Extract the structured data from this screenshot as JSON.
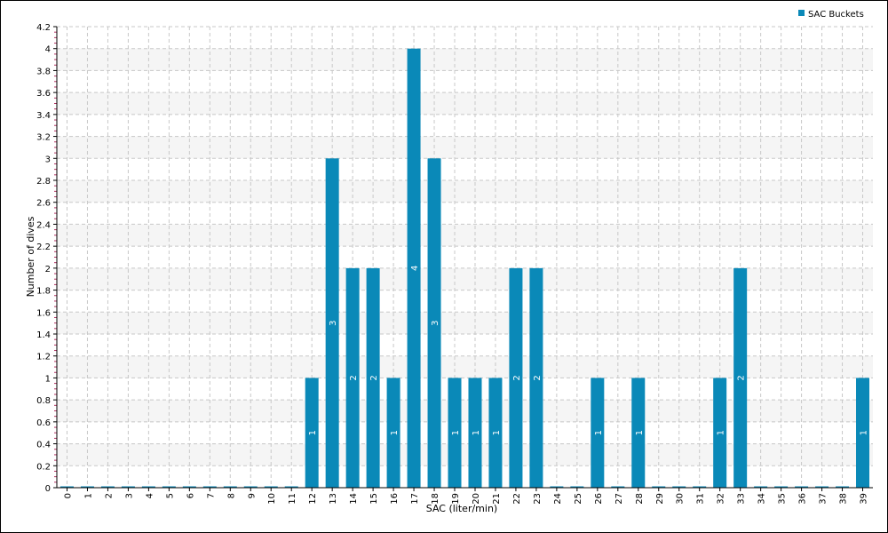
{
  "chart_data": {
    "type": "bar",
    "title": "",
    "xlabel": "SAC (liter/min)",
    "ylabel": "Number of dives",
    "ylim": [
      0,
      4.2
    ],
    "y_ticks": [
      "0",
      "0.2",
      "0.4",
      "0.6",
      "0.8",
      "1",
      "1.2",
      "1.4",
      "1.6",
      "1.8",
      "2",
      "2.2",
      "2.4",
      "2.6",
      "2.8",
      "3",
      "3.2",
      "3.4",
      "3.6",
      "3.8",
      "4",
      "4.2"
    ],
    "categories": [
      "0",
      "1",
      "2",
      "3",
      "4",
      "5",
      "6",
      "7",
      "8",
      "9",
      "10",
      "11",
      "12",
      "13",
      "14",
      "15",
      "16",
      "17",
      "18",
      "19",
      "20",
      "21",
      "22",
      "23",
      "24",
      "25",
      "26",
      "27",
      "28",
      "29",
      "30",
      "31",
      "32",
      "33",
      "34",
      "35",
      "36",
      "37",
      "38",
      "39"
    ],
    "series": [
      {
        "name": "SAC Buckets",
        "values": [
          0,
          0,
          0,
          0,
          0,
          0,
          0,
          0,
          0,
          0,
          0,
          0,
          1,
          3,
          2,
          2,
          1,
          4,
          3,
          1,
          1,
          1,
          2,
          2,
          0,
          0,
          1,
          0,
          1,
          0,
          0,
          0,
          1,
          2,
          0,
          0,
          0,
          0,
          0,
          1
        ]
      }
    ],
    "grid": true,
    "legend_position": "top-right",
    "colors": {
      "bar": "#0a89b8",
      "band": "#f5f5f5",
      "grid": "#c8c8c8",
      "axis": "#000000",
      "minor_tick": "#b03060"
    }
  }
}
